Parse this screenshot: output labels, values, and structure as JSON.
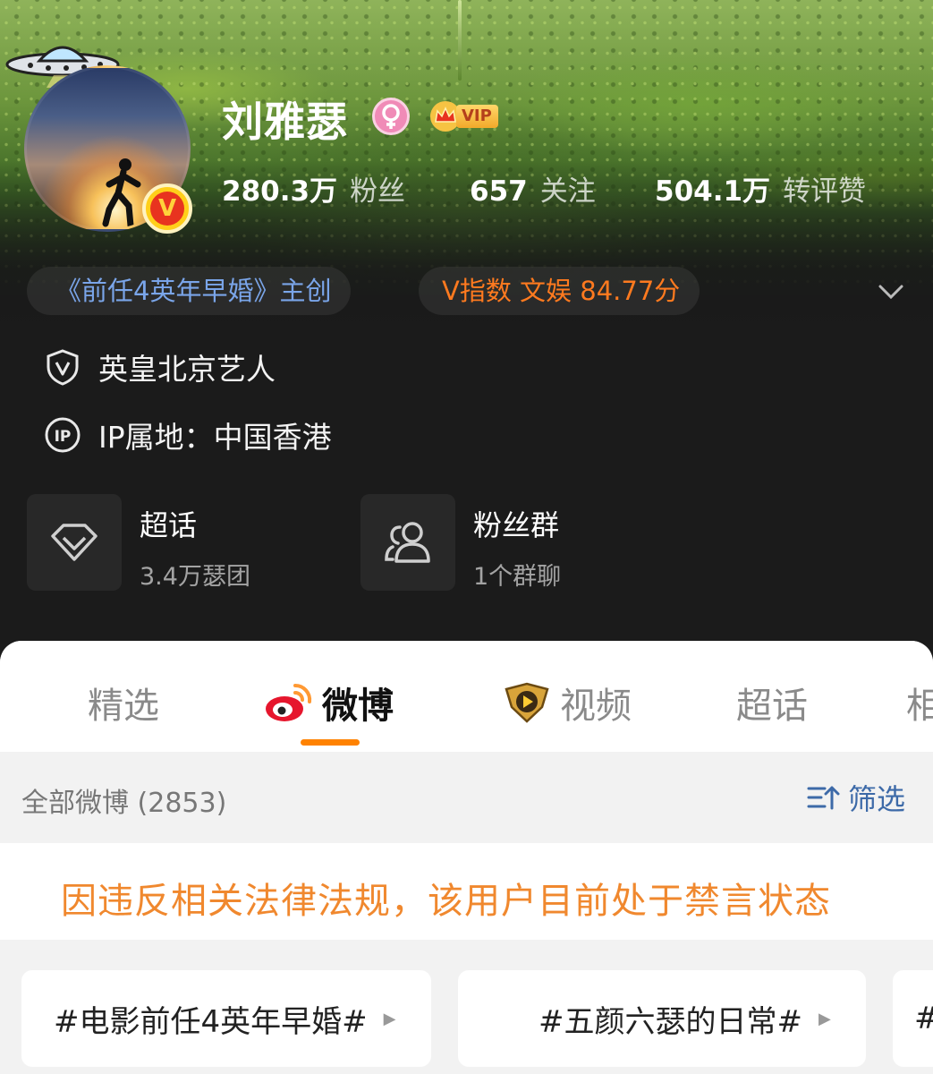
{
  "profile": {
    "name": "刘雅瑟",
    "verify_mark": "V",
    "vip_label": "VIP",
    "stats": [
      {
        "value": "280.3万",
        "label": "粉丝"
      },
      {
        "value": "657",
        "label": "关注"
      },
      {
        "value": "504.1万",
        "label": "转评赞"
      }
    ],
    "tags": {
      "work": "《前任4英年早婚》主创",
      "v_index": "V指数  文娱  84.77分"
    },
    "info": {
      "company": "英皇北京艺人",
      "ip": "IP属地：中国香港"
    },
    "features": {
      "super_topic": {
        "title": "超话",
        "sub": "3.4万瑟团"
      },
      "fan_group": {
        "title": "粉丝群",
        "sub": "1个群聊"
      }
    }
  },
  "tabs": [
    {
      "label": "精选",
      "active": false
    },
    {
      "label": "微博",
      "active": true
    },
    {
      "label": "视频",
      "active": false
    },
    {
      "label": "超话",
      "active": false
    },
    {
      "label": "相",
      "active": false
    }
  ],
  "feed": {
    "all_label": "全部微博 (2853)",
    "filter_label": "筛选",
    "notice": "因违反相关法律法规，该用户目前处于禁言状态",
    "topics": [
      "#电影前任4英年早婚#",
      "#五颜六瑟的日常#",
      "#"
    ]
  },
  "colors": {
    "accent_orange": "#ff8200",
    "notice_orange": "#f0882e",
    "link_blue": "#7aa5e9",
    "filter_blue": "#3d6aa8",
    "v_index_orange": "#ff7a1f"
  },
  "icons": [
    "ufo-icon",
    "verified-badge-icon",
    "female-icon",
    "vip-crown-icon",
    "chevron-down-icon",
    "shield-v-icon",
    "ip-icon",
    "diamond-icon",
    "group-icon",
    "weibo-logo-icon",
    "video-badge-icon",
    "filter-sort-icon",
    "play-arrow-icon"
  ]
}
